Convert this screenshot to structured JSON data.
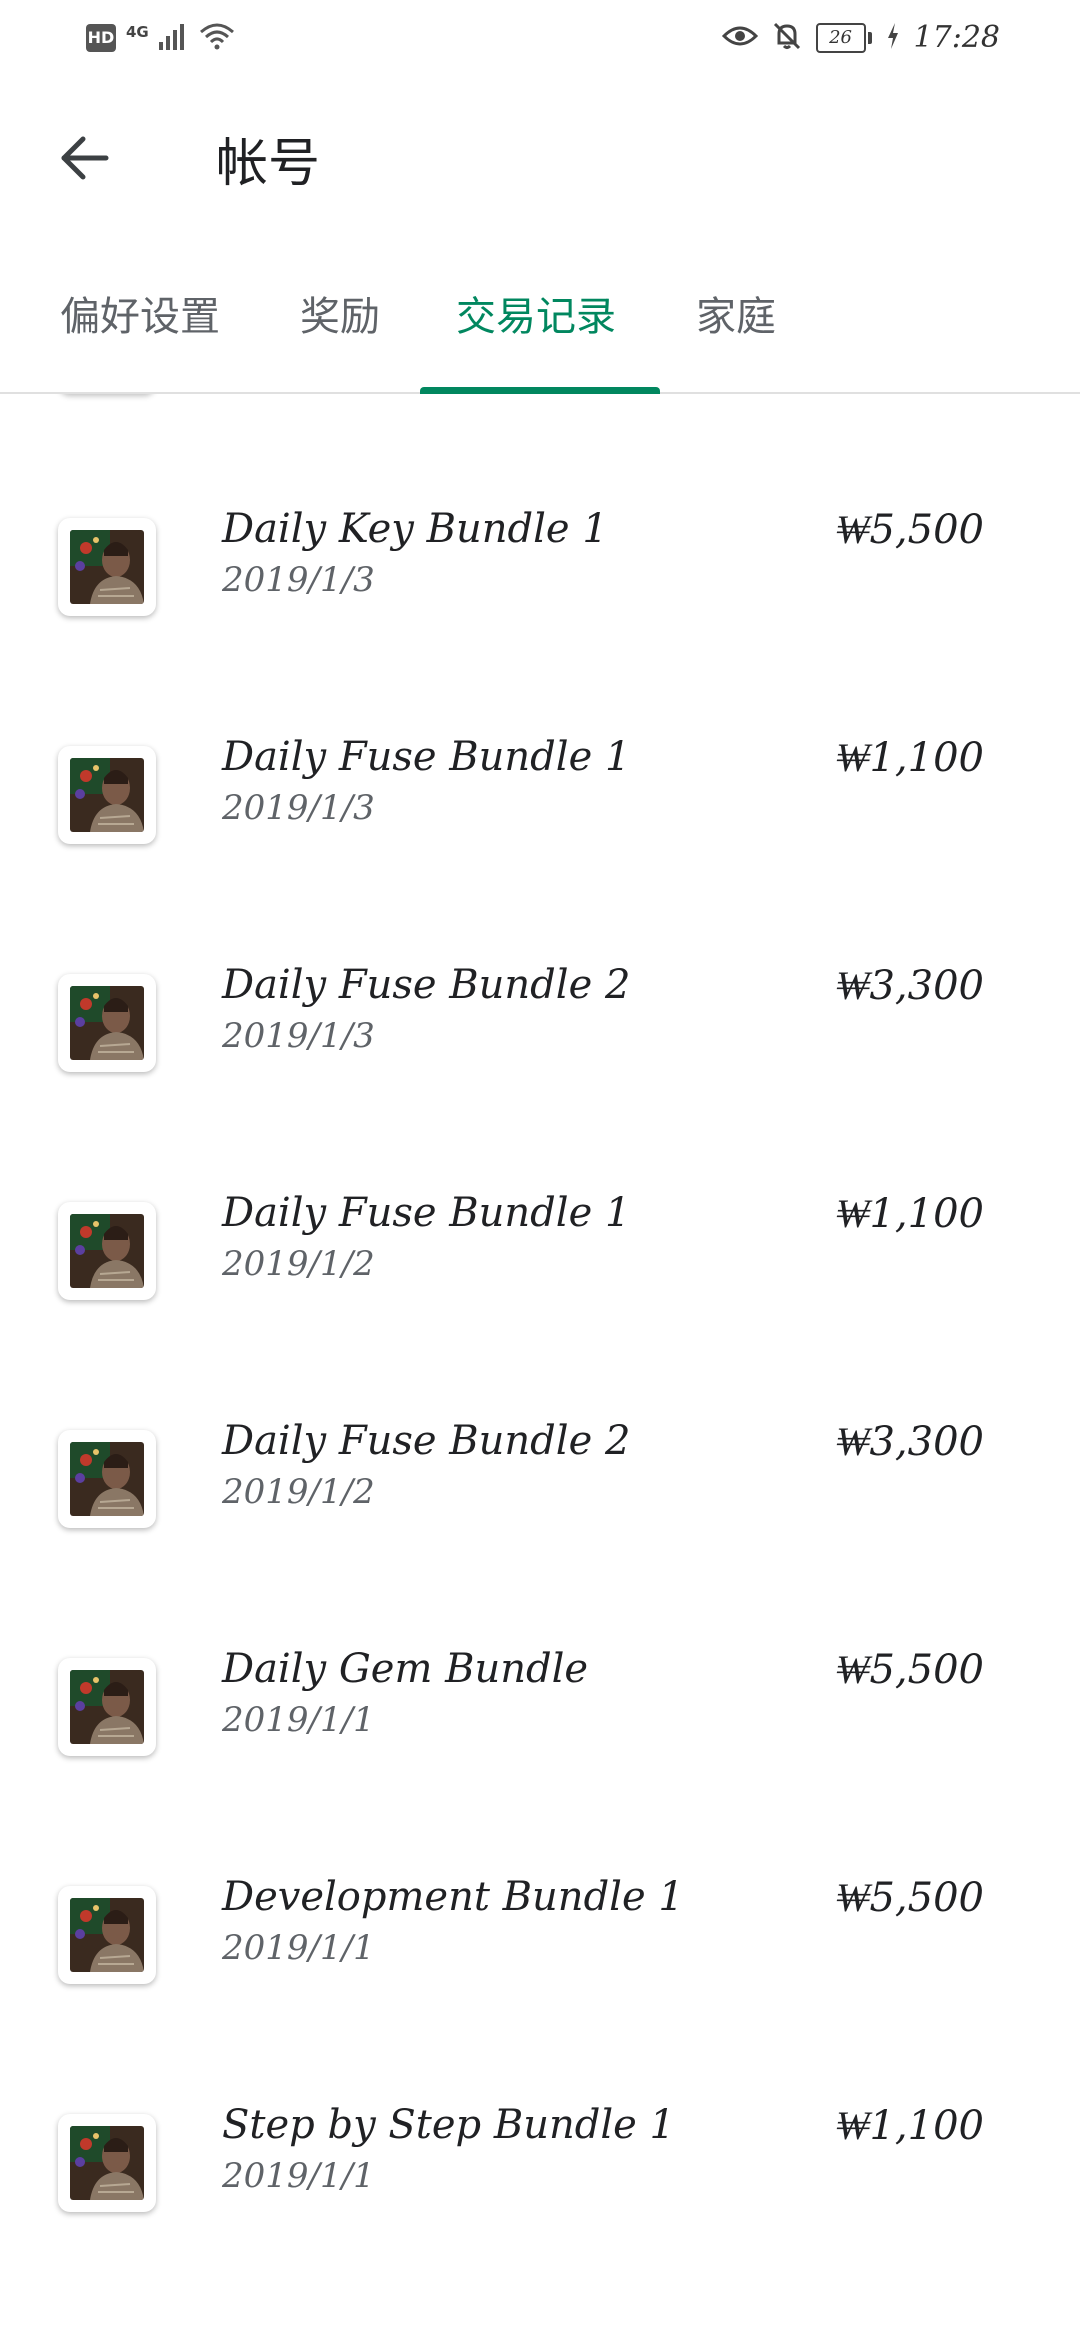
{
  "status_bar": {
    "network_hd": "HD",
    "network_type": "4G",
    "battery_level": "26",
    "time": "17:28",
    "icons": [
      "hd-icon",
      "signal-icon",
      "wifi-icon",
      "eye-icon",
      "bell-off-icon",
      "battery-icon",
      "charging-icon"
    ]
  },
  "header": {
    "title": "帐号",
    "back_icon": "arrow-left-icon"
  },
  "tabs": [
    {
      "label": "偏好设置",
      "active": false
    },
    {
      "label": "奖励",
      "active": false
    },
    {
      "label": "交易记录",
      "active": true
    },
    {
      "label": "家庭",
      "active": false
    }
  ],
  "accent_color": "#01875f",
  "transactions": [
    {
      "name": "Daily Key Bundle 1",
      "date": "2019/1/3",
      "price": "₩5,500"
    },
    {
      "name": "Daily Fuse Bundle 1",
      "date": "2019/1/3",
      "price": "₩1,100"
    },
    {
      "name": "Daily Fuse Bundle 2",
      "date": "2019/1/3",
      "price": "₩3,300"
    },
    {
      "name": "Daily Fuse Bundle 1",
      "date": "2019/1/2",
      "price": "₩1,100"
    },
    {
      "name": "Daily Fuse Bundle 2",
      "date": "2019/1/2",
      "price": "₩3,300"
    },
    {
      "name": "Daily Gem Bundle",
      "date": "2019/1/1",
      "price": "₩5,500"
    },
    {
      "name": "Development Bundle 1",
      "date": "2019/1/1",
      "price": "₩5,500"
    },
    {
      "name": "Step by Step Bundle 1",
      "date": "2019/1/1",
      "price": "₩1,100"
    }
  ]
}
